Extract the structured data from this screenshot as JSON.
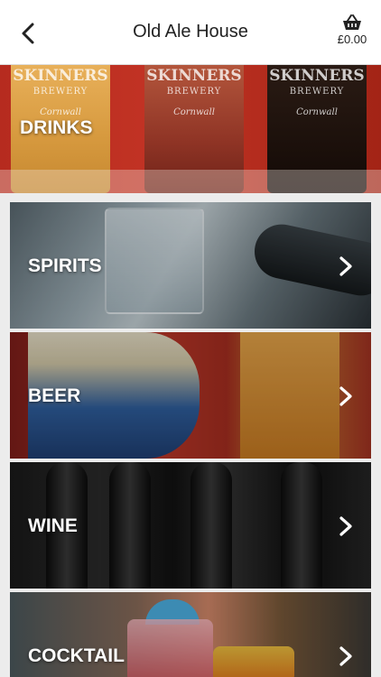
{
  "header": {
    "title": "Old Ale House",
    "basket_amount": "£0.00",
    "back_icon": "chevron-left-icon",
    "basket_icon": "basket-icon"
  },
  "hero": {
    "label": "DRINKS",
    "glasses": [
      {
        "brand": "SKINNERS",
        "sub": "BREWERY",
        "loc": "Cornwall"
      },
      {
        "brand": "SKINNERS",
        "sub": "BREWERY",
        "loc": "Cornwall"
      },
      {
        "brand": "SKINNERS",
        "sub": "BREWERY",
        "loc": "Cornwall"
      }
    ]
  },
  "categories": [
    {
      "label": "SPIRITS",
      "icon": "chevron-right-icon"
    },
    {
      "label": "BEER",
      "icon": "chevron-right-icon"
    },
    {
      "label": "WINE",
      "icon": "chevron-right-icon"
    },
    {
      "label": "COCKTAIL",
      "icon": "chevron-right-icon"
    }
  ]
}
